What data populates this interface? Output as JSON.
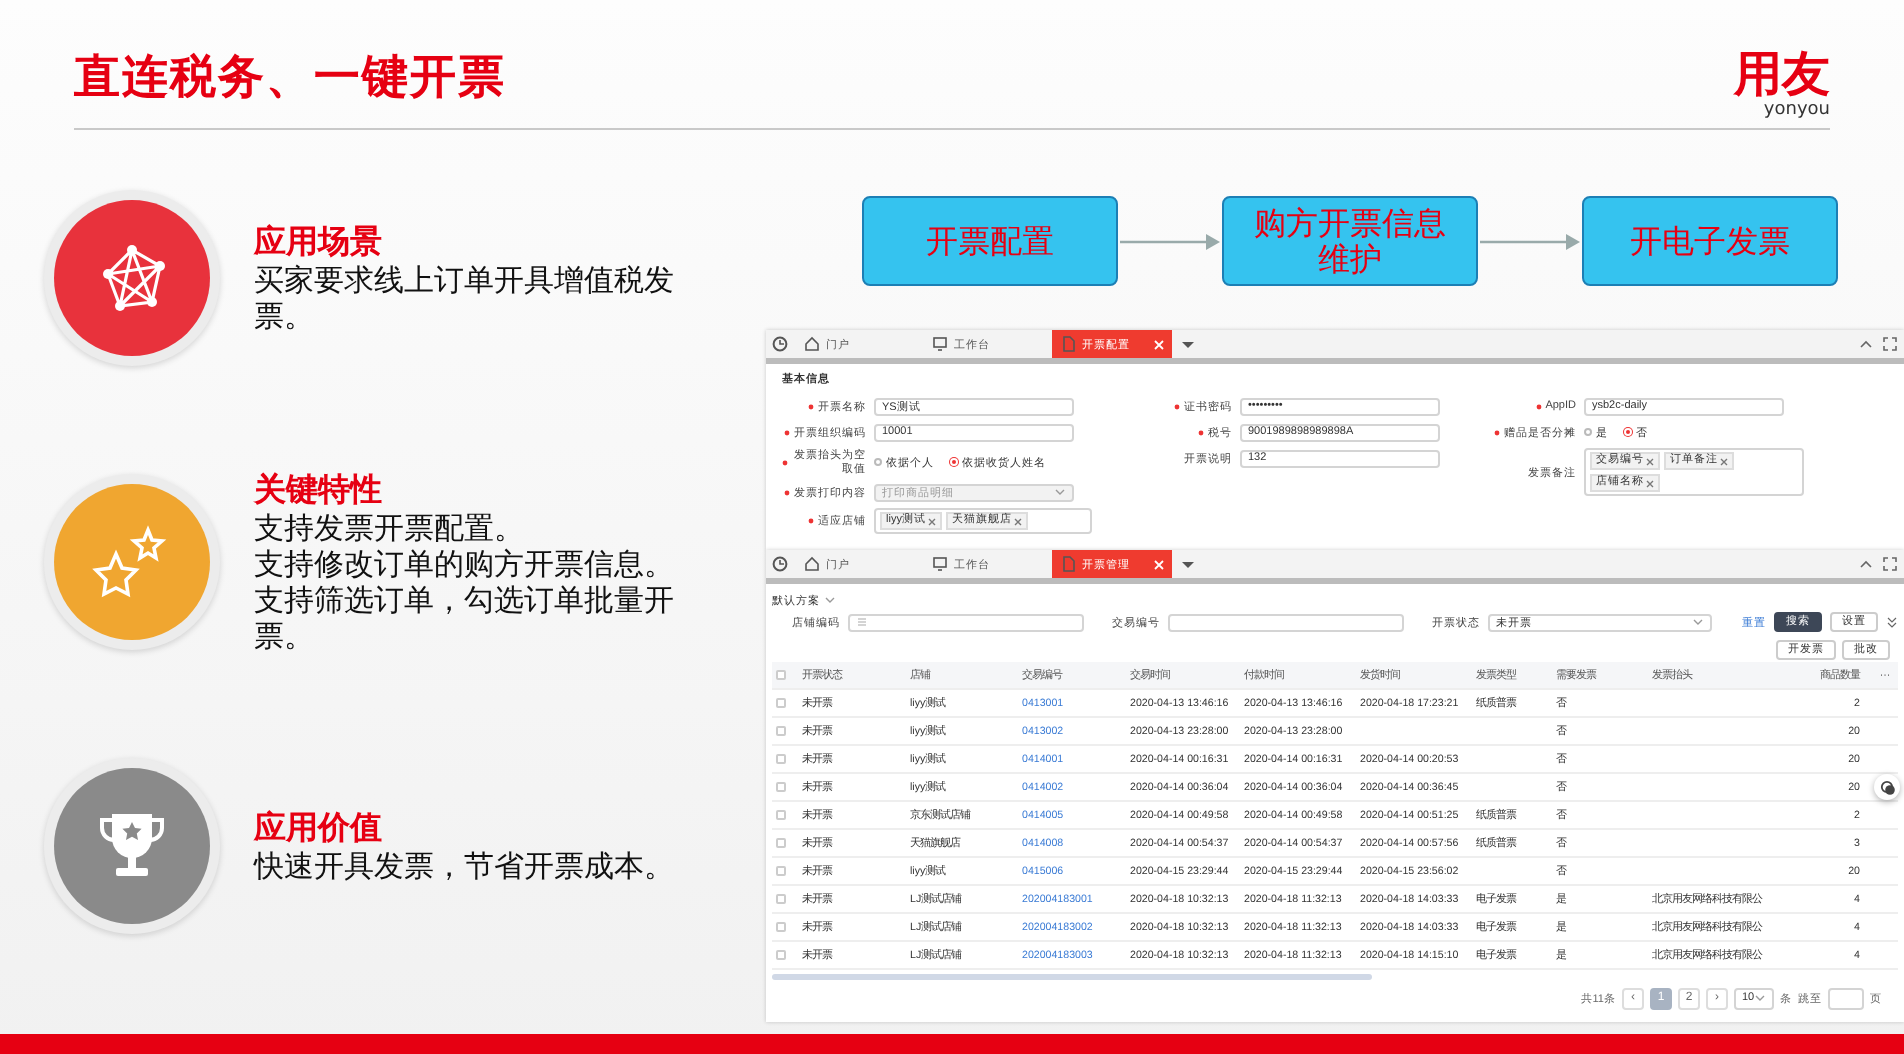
{
  "header": {
    "title": "直连税务、一键开票",
    "logo": {
      "name": "用友",
      "sub": "yonyou"
    }
  },
  "features": [
    {
      "kind": "network",
      "color": "#e8323c",
      "heading": "应用场景",
      "lines": [
        "买家要求线上订单开具增值税发票。"
      ]
    },
    {
      "kind": "stars",
      "color": "#f0a630",
      "heading": "关键特性",
      "lines": [
        "支持发票开票配置。",
        "支持修改订单的购方开票信息。",
        "支持筛选订单，勾选订单批量开票。"
      ]
    },
    {
      "kind": "trophy",
      "color": "#8a8a8a",
      "heading": "应用价值",
      "lines": [
        "快速开具发票，节省开票成本。"
      ]
    }
  ],
  "flow": {
    "steps": [
      "开票配置",
      "购方开票信息维护",
      "开电子发票"
    ]
  },
  "config_window": {
    "tabs": [
      {
        "kind": "home",
        "label": "门户",
        "selected": false
      },
      {
        "kind": "desk",
        "label": "工作台",
        "selected": false
      },
      {
        "kind": "doc",
        "label": "开票配置",
        "selected": true
      }
    ],
    "section": "基本信息",
    "columns": [
      [
        {
          "label": "开票名称",
          "required": true,
          "kind": "input",
          "value": "YS测试"
        },
        {
          "label": "开票组织编码",
          "required": true,
          "kind": "input",
          "value": "10001"
        },
        {
          "label": "发票抬头为空取值",
          "required": true,
          "kind": "radio",
          "options": [
            {
              "label": "依据个人",
              "selected": false
            },
            {
              "label": "依据收货人姓名",
              "selected": true
            }
          ]
        },
        {
          "label": "发票打印内容",
          "required": true,
          "kind": "select",
          "value": "打印商品明细",
          "disabled": true
        },
        {
          "label": "适应店铺",
          "required": true,
          "kind": "tags",
          "tags": [
            "liyy测试",
            "天猫旗舰店"
          ]
        }
      ],
      [
        {
          "label": "证书密码",
          "required": true,
          "kind": "input",
          "value": "•••••••••"
        },
        {
          "label": "税号",
          "required": true,
          "kind": "input",
          "value": "9001989898989898A"
        },
        {
          "label": "开票说明",
          "required": false,
          "kind": "input",
          "value": "132"
        }
      ],
      [
        {
          "label": "AppID",
          "required": true,
          "kind": "input",
          "value": "ysb2c-daily"
        },
        {
          "label": "赠品是否分摊",
          "required": true,
          "kind": "radio",
          "options": [
            {
              "label": "是",
              "selected": false
            },
            {
              "label": "否",
              "selected": true
            }
          ]
        },
        {
          "label": "发票备注",
          "required": false,
          "kind": "tags",
          "tags": [
            "交易编号",
            "订单备注",
            "店铺名称"
          ]
        }
      ]
    ]
  },
  "manage_window": {
    "tabs": [
      {
        "kind": "home",
        "label": "门户",
        "selected": false
      },
      {
        "kind": "desk",
        "label": "工作台",
        "selected": false
      },
      {
        "kind": "doc",
        "label": "开票管理",
        "selected": true
      }
    ],
    "scheme": "默认方案",
    "filters": [
      {
        "label": "店铺编码",
        "kind": "picker"
      },
      {
        "label": "交易编号",
        "kind": "input"
      },
      {
        "label": "开票状态",
        "kind": "select",
        "value": "未开票"
      }
    ],
    "reset": "重置",
    "search": "搜索",
    "settings": "设置",
    "toolbar": [
      "开发票",
      "批改"
    ],
    "table": {
      "all_checked": false,
      "more": "···",
      "columns": [
        {
          "label": "开票状态",
          "kind": "text"
        },
        {
          "label": "店铺",
          "kind": "text"
        },
        {
          "label": "交易编号",
          "kind": "link"
        },
        {
          "label": "交易时间",
          "kind": "text"
        },
        {
          "label": "付款时间",
          "kind": "text"
        },
        {
          "label": "发货时间",
          "kind": "text"
        },
        {
          "label": "发票类型",
          "kind": "text"
        },
        {
          "label": "需要发票",
          "kind": "text"
        },
        {
          "label": "发票抬头",
          "kind": "text"
        },
        {
          "label": "商品数量",
          "kind": "number"
        }
      ],
      "rows": [
        {
          "checked": false,
          "cells": [
            "未开票",
            "liyy测试",
            "0413001",
            "2020-04-13 13:46:16",
            "2020-04-13 13:46:16",
            "2020-04-18 17:23:21",
            "纸质普票",
            "否",
            null,
            "2"
          ]
        },
        {
          "checked": false,
          "cells": [
            "未开票",
            "liyy测试",
            "0413002",
            "2020-04-13 23:28:00",
            "2020-04-13 23:28:00",
            null,
            null,
            "否",
            null,
            "20"
          ]
        },
        {
          "checked": false,
          "cells": [
            "未开票",
            "liyy测试",
            "0414001",
            "2020-04-14 00:16:31",
            "2020-04-14 00:16:31",
            "2020-04-14 00:20:53",
            null,
            "否",
            null,
            "20"
          ]
        },
        {
          "checked": false,
          "cells": [
            "未开票",
            "liyy测试",
            "0414002",
            "2020-04-14 00:36:04",
            "2020-04-14 00:36:04",
            "2020-04-14 00:36:45",
            null,
            "否",
            null,
            "20"
          ]
        },
        {
          "checked": false,
          "cells": [
            "未开票",
            "京东测试店铺",
            "0414005",
            "2020-04-14 00:49:58",
            "2020-04-14 00:49:58",
            "2020-04-14 00:51:25",
            "纸质普票",
            "否",
            null,
            "2"
          ]
        },
        {
          "checked": false,
          "cells": [
            "未开票",
            "天猫旗舰店",
            "0414008",
            "2020-04-14 00:54:37",
            "2020-04-14 00:54:37",
            "2020-04-14 00:57:56",
            "纸质普票",
            "否",
            null,
            "3"
          ]
        },
        {
          "checked": false,
          "cells": [
            "未开票",
            "liyy测试",
            "0415006",
            "2020-04-15 23:29:44",
            "2020-04-15 23:29:44",
            "2020-04-15 23:56:02",
            null,
            "否",
            null,
            "20"
          ]
        },
        {
          "checked": false,
          "cells": [
            "未开票",
            "LJ测试店铺",
            "202004183001",
            "2020-04-18 10:32:13",
            "2020-04-18 11:32:13",
            "2020-04-18 14:03:33",
            "电子发票",
            "是",
            "北京用友网络科技有限公",
            "4"
          ]
        },
        {
          "checked": false,
          "cells": [
            "未开票",
            "LJ测试店铺",
            "202004183002",
            "2020-04-18 10:32:13",
            "2020-04-18 11:32:13",
            "2020-04-18 14:03:33",
            "电子发票",
            "是",
            "北京用友网络科技有限公",
            "4"
          ]
        },
        {
          "checked": false,
          "cells": [
            "未开票",
            "LJ测试店铺",
            "202004183003",
            "2020-04-18 10:32:13",
            "2020-04-18 11:32:13",
            "2020-04-18 14:15:10",
            "电子发票",
            "是",
            "北京用友网络科技有限公",
            "4"
          ]
        }
      ]
    },
    "pagination": {
      "total": "共11条",
      "prev": "‹",
      "next": "›",
      "pages": [
        {
          "label": "1",
          "selected": true
        },
        {
          "label": "2",
          "selected": false
        }
      ],
      "page_size": "10",
      "unit": "条",
      "jump_label": "跳至",
      "page_unit": "页"
    }
  }
}
